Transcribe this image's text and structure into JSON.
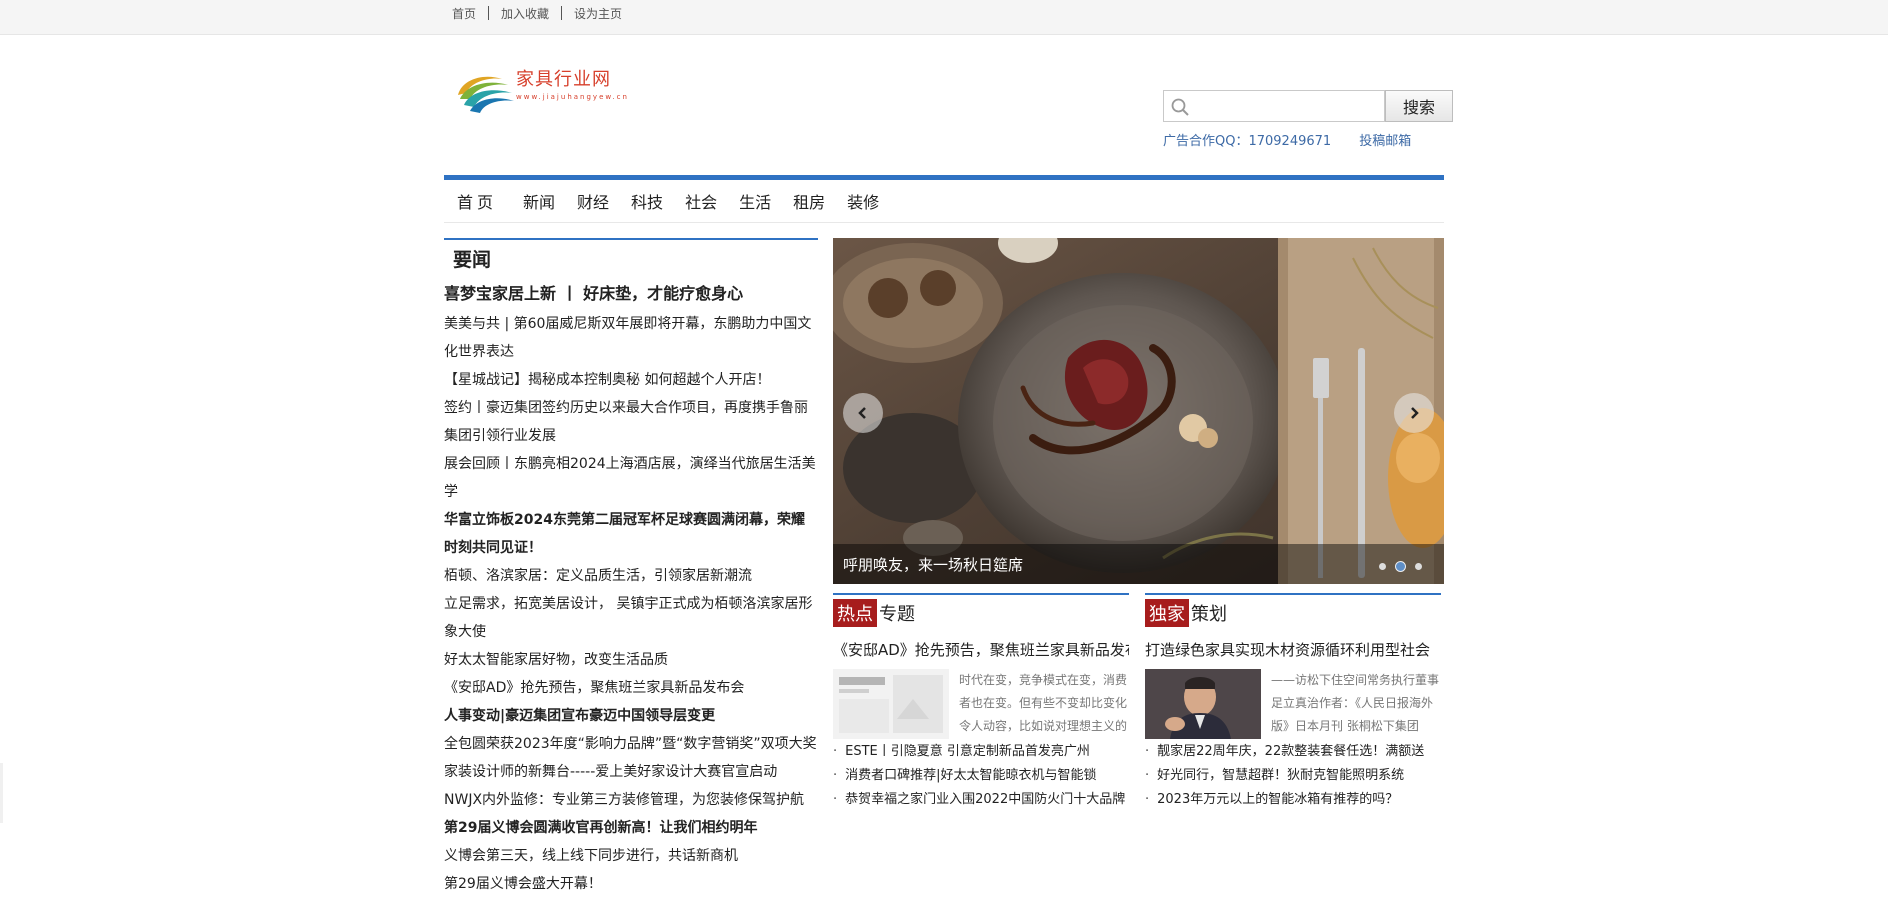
{
  "topbar": {
    "links": [
      "首页",
      "加入收藏",
      "设为主页"
    ]
  },
  "header": {
    "logo_cn": "家具行业网",
    "logo_en": "www.jiajuhangyew.cn",
    "search_placeholder": "",
    "search_button": "搜索",
    "ad_contact": "广告合作QQ：1709249671",
    "submit_mail": "投稿邮箱"
  },
  "nav": {
    "items": [
      "首页",
      "新闻",
      "财经",
      "科技",
      "社会",
      "生活",
      "租房",
      "装修"
    ]
  },
  "headlines": {
    "title": "要闻",
    "items": [
      {
        "text": "喜梦宝家居上新 丨 好床垫，才能疗愈身心",
        "style": "big"
      },
      {
        "text": "美美与共 | 第60届威尼斯双年展即将开幕，东鹏助力中国文化世界表达",
        "style": "normal"
      },
      {
        "text": "【星城战记】揭秘成本控制奥秘 如何超越个人开店！",
        "style": "normal"
      },
      {
        "text": "签约丨豪迈集团签约历史以来最大合作项目，再度携手鲁丽集团引领行业发展",
        "style": "normal"
      },
      {
        "text": "展会回顾丨东鹏亮相2024上海酒店展，演绎当代旅居生活美学",
        "style": "normal"
      },
      {
        "text": "华富立饰板2024东莞第二届冠军杯足球赛圆满闭幕，荣耀时刻共同见证！",
        "style": "bold"
      },
      {
        "text": "栢顿、洛滨家居：定义品质生活，引领家居新潮流",
        "style": "normal"
      },
      {
        "text": "立足需求，拓宽美居设计， 吴镇宇正式成为栢顿洛滨家居形象大使",
        "style": "normal"
      },
      {
        "text": " 好太太智能家居好物，改变生活品质",
        "style": "normal"
      },
      {
        "text": "《安邸AD》抢先预告，聚焦班兰家具新品发布会",
        "style": "normal"
      },
      {
        "text": "人事变动|豪迈集团宣布豪迈中国领导层变更",
        "style": "bold"
      },
      {
        "text": "全包圆荣获2023年度“影响力品牌”暨“数字营销奖”双项大奖",
        "style": "normal"
      },
      {
        "text": "家装设计师的新舞台-----爱上美好家设计大赛官宣启动",
        "style": "normal"
      },
      {
        "text": "NWJX内外监修：专业第三方装修管理，为您装修保驾护航",
        "style": "normal"
      },
      {
        "text": "第29届义博会圆满收官再创新高！让我们相约明年",
        "style": "bold"
      },
      {
        "text": "义博会第三天，线上线下同步进行，共话新商机",
        "style": "normal"
      },
      {
        "text": "第29届义博会盛大开幕！",
        "style": "normal"
      }
    ]
  },
  "slider": {
    "caption": "呼朋唤友，来一场秋日筵席",
    "slide_count": 3,
    "active_index": 1
  },
  "hot_topic": {
    "tag": "热点",
    "title": "专题",
    "headline": "《安邸AD》抢先预告，聚焦班兰家具新品发布会",
    "desc": "时代在变，竞争模式在变，消费者也在变。但有些不变却比变化令人动容，比如说对理想主义的践行",
    "links": [
      "ESTE丨引隐夏意 引意定制新品首发亮广州",
      "消费者口碑推荐|好太太智能晾衣机与智能锁",
      "恭贺幸福之家门业入围2022中国防火门十大品牌"
    ]
  },
  "exclusive": {
    "tag": "独家",
    "title": "策划",
    "headline": "打造绿色家具实现木材资源循环利用型社会",
    "desc": "——访松下住空间常务执行董事足立真治作者：《人民日报海外版》日本月刊 张桐松下集团",
    "links": [
      "靓家居22周年庆，22款整装套餐任选！满额送",
      "好光同行，智慧超群！狄耐克智能照明系统",
      "2023年万元以上的智能冰箱有推荐的吗？"
    ]
  },
  "colors": {
    "accent_blue": "#2f72c3",
    "tag_red": "#a71d1d",
    "logo_red": "#d7402c",
    "contact_blue": "#3d6aa6"
  }
}
